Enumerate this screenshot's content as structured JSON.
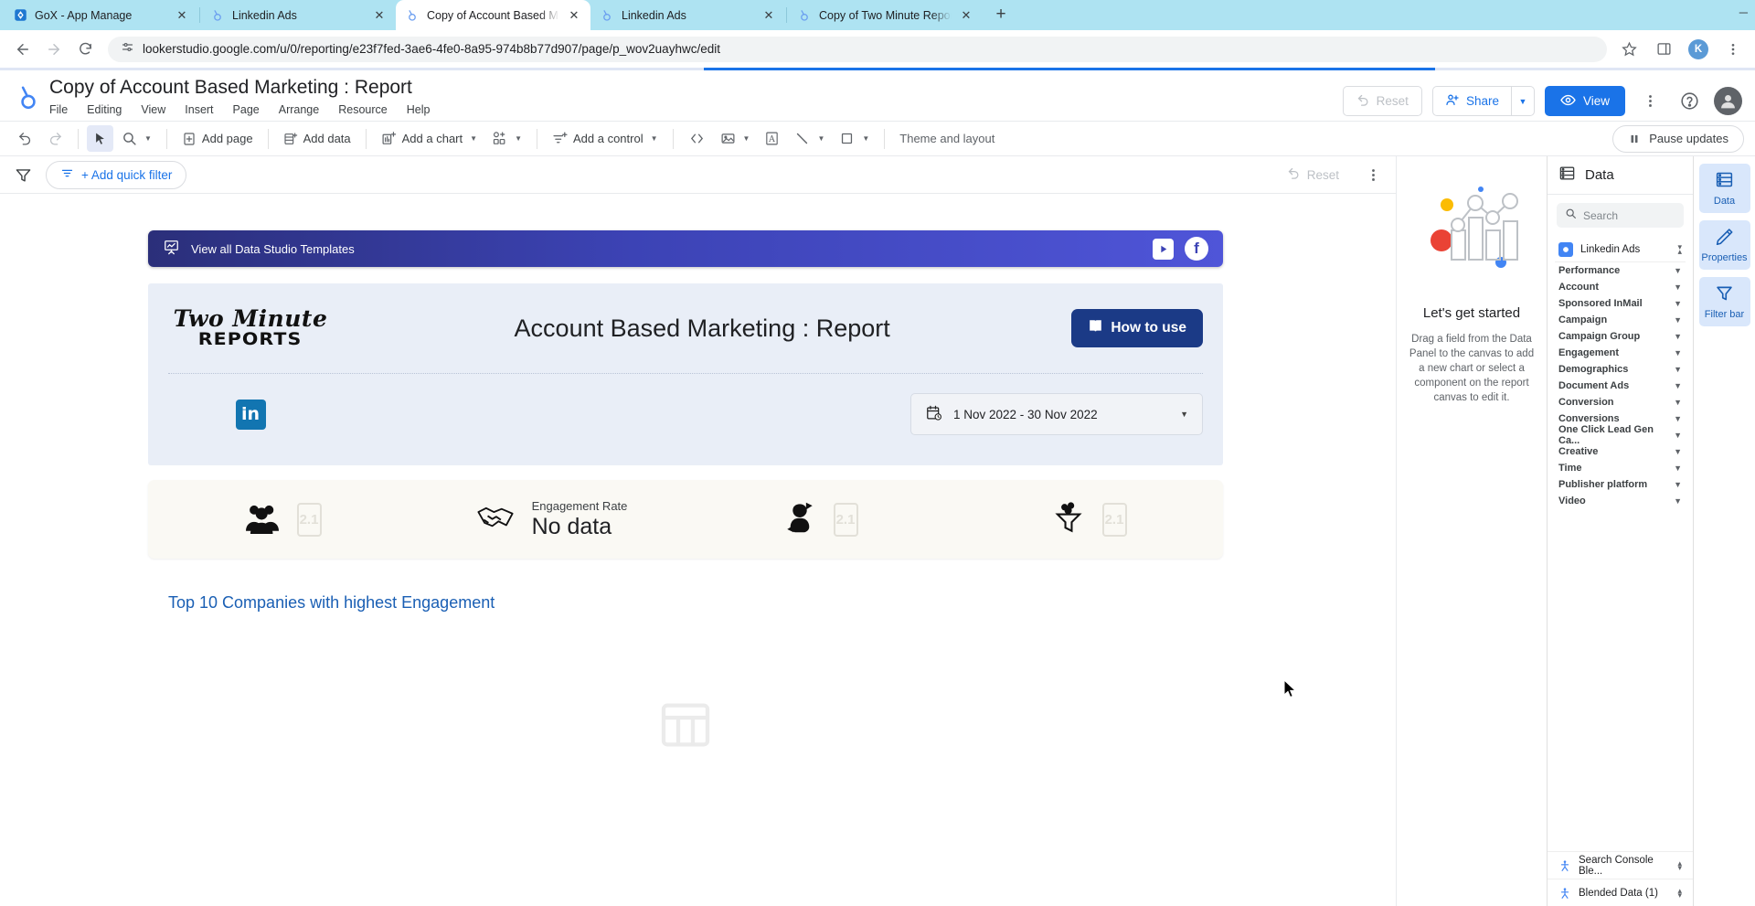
{
  "browser": {
    "tabs": [
      {
        "title": "GoX - App Manage",
        "favicon": "gox-icon",
        "active": false
      },
      {
        "title": "Linkedin Ads",
        "favicon": "looker-icon",
        "active": false
      },
      {
        "title": "Copy of Account Based Marke",
        "favicon": "looker-icon",
        "active": true
      },
      {
        "title": "Linkedin Ads",
        "favicon": "looker-icon",
        "active": false
      },
      {
        "title": "Copy of Two Minute Reports",
        "favicon": "looker-icon",
        "active": false
      }
    ],
    "new_tab_label": "+",
    "url": "lookerstudio.google.com/u/0/reporting/e23f7fed-3ae6-4fe0-8a95-974b8b77d907/page/p_wov2uayhwc/edit",
    "profile_initial": "K"
  },
  "app": {
    "report_title": "Copy of Account Based Marketing : Report",
    "menus": [
      "File",
      "Editing",
      "View",
      "Insert",
      "Page",
      "Arrange",
      "Resource",
      "Help"
    ],
    "actions": {
      "reset": "Reset",
      "share": "Share",
      "view": "View"
    },
    "toolbar": {
      "add_page": "Add page",
      "add_data": "Add data",
      "add_chart": "Add a chart",
      "add_control": "Add a control",
      "theme_and_layout": "Theme and layout",
      "pause_updates": "Pause updates"
    },
    "filter_bar": {
      "add_quick_filter": "+ Add quick filter",
      "reset": "Reset"
    }
  },
  "report": {
    "banner": {
      "label": "View all Data Studio Templates",
      "youtube_icon": "youtube-icon",
      "facebook_icon": "facebook-icon"
    },
    "brand": {
      "line1": "Two Minute",
      "line2": "REPORTS"
    },
    "heading": "Account Based Marketing : Report",
    "how_to_use": "How to use",
    "date_range": "1 Nov 2022 - 30 Nov 2022",
    "scorecards": [
      {
        "icon": "people-icon",
        "label": "",
        "value": "",
        "placeholder": "2.1"
      },
      {
        "icon": "handshake-icon",
        "label": "Engagement Rate",
        "value": "No data",
        "placeholder": ""
      },
      {
        "icon": "engagement-icon",
        "label": "",
        "value": "",
        "placeholder": "2.1"
      },
      {
        "icon": "funnel-icon",
        "label": "",
        "value": "",
        "placeholder": "2.1"
      }
    ],
    "table_title": "Top 10 Companies with highest Engagement"
  },
  "get_started": {
    "title": "Let's get started",
    "text": "Drag a field from the Data Panel to the canvas to add a new chart or select a component on the report canvas to edit it."
  },
  "data_panel": {
    "header": "Data",
    "search_placeholder": "Search",
    "source": "Linkedin Ads",
    "fields": [
      "Performance",
      "Account",
      "Sponsored InMail",
      "Campaign",
      "Campaign Group",
      "Engagement",
      "Demographics",
      "Document Ads",
      "Conversion",
      "Conversions",
      "One Click Lead Gen Ca...",
      "Creative",
      "Time",
      "Publisher platform",
      "Video"
    ],
    "blends": [
      "Search Console Ble...",
      "Blended Data (1)"
    ]
  },
  "right_rail": [
    {
      "label": "Data",
      "icon": "data-icon"
    },
    {
      "label": "Properties",
      "icon": "pencil-icon"
    },
    {
      "label": "Filter bar",
      "icon": "filter-icon"
    }
  ],
  "colors": {
    "accent_blue": "#1a73e8",
    "banner_gradient_start": "#2b2f7a",
    "banner_gradient_end": "#4f55d8",
    "card_bg": "#e9eef7",
    "score_bg": "#faf9f4",
    "how_to_use_bg": "#1b3a86",
    "linkedin_blue": "#1275b1",
    "table_title": "#1a5fb4"
  }
}
